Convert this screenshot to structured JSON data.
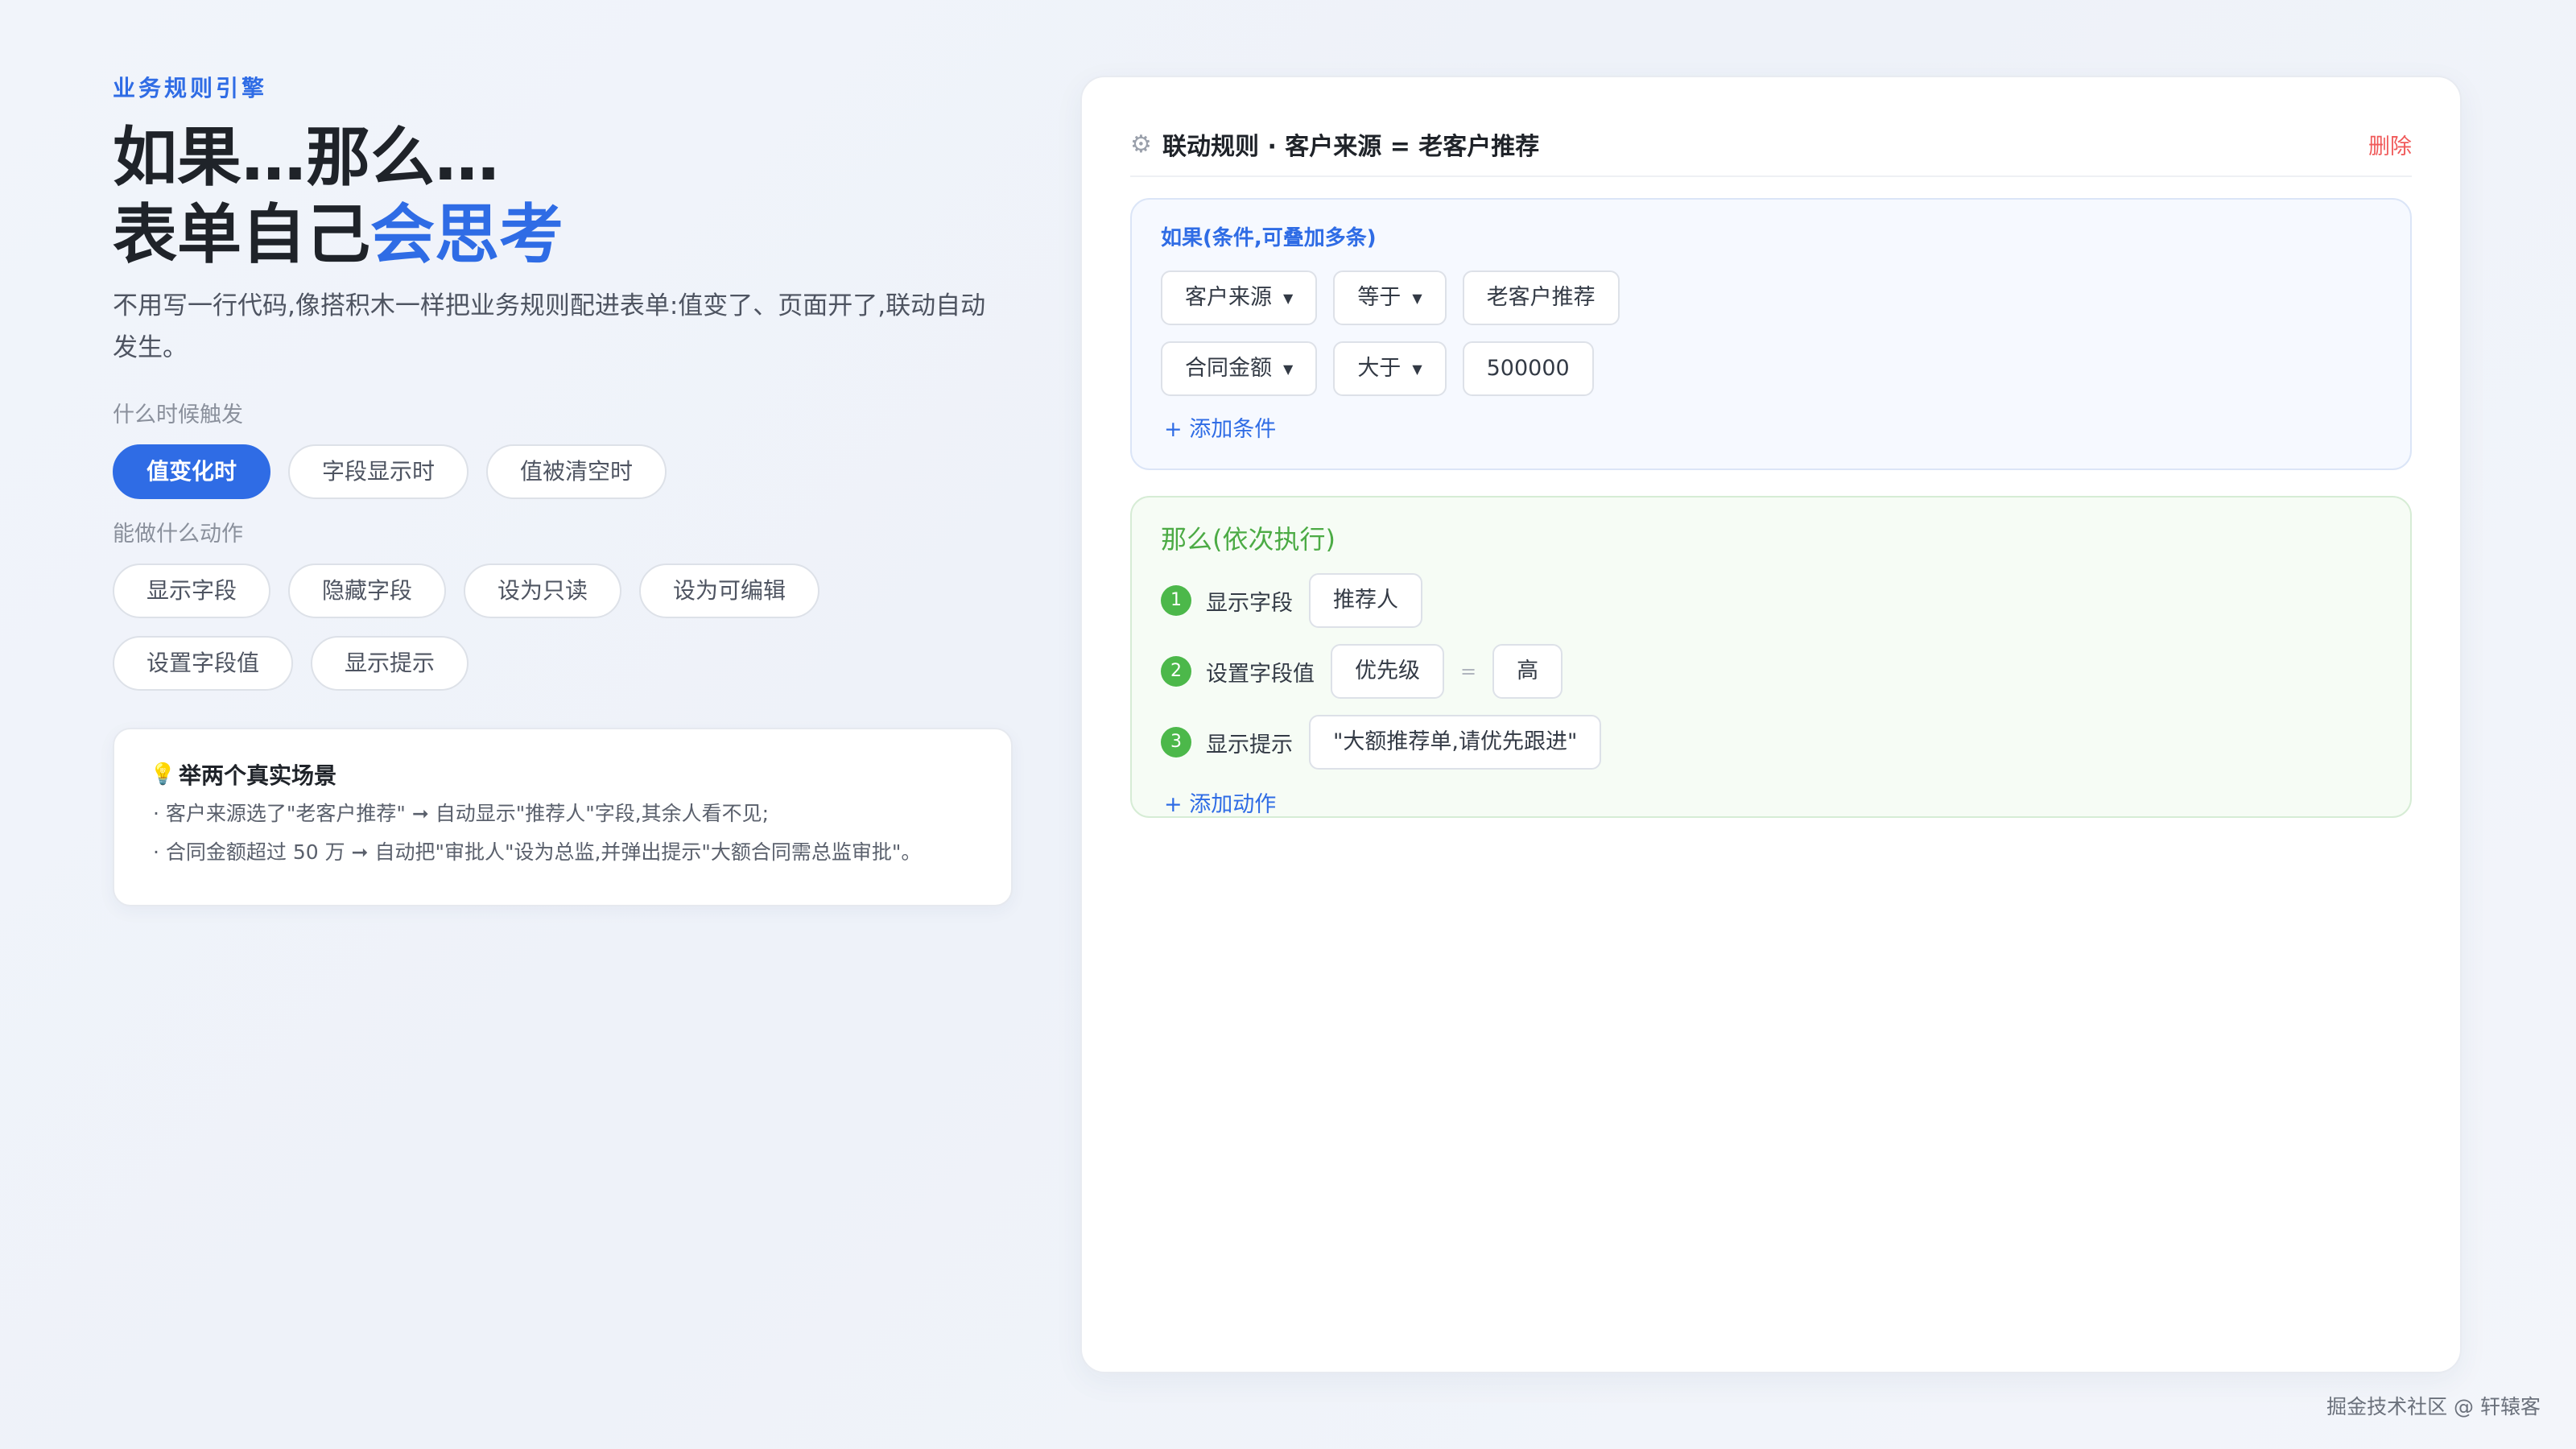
{
  "left": {
    "eyebrow": "业务规则引擎",
    "title_line1": "如果…那么…",
    "title_line2_prefix": "表单自己",
    "title_line2_accent": "会思考",
    "description": "不用写一行代码,像搭积木一样把业务规则配进表单:值变了、页面开了,联动自动发生。",
    "trigger_label": "什么时候触发",
    "triggers": [
      "值变化时",
      "字段显示时",
      "值被清空时"
    ],
    "action_label": "能做什么动作",
    "actions": [
      "显示字段",
      "隐藏字段",
      "设为只读",
      "设为可编辑",
      "设置字段值",
      "显示提示"
    ],
    "scenario": {
      "icon": "lightbulb-icon",
      "title": "举两个真实场景",
      "line1": "· 客户来源选了\"老客户推荐\" ➞ 自动显示\"推荐人\"字段,其余人看不见;",
      "line2": "· 合同金额超过 50 万 ➞ 自动把\"审批人\"设为总监,并弹出提示\"大额合同需总监审批\"。"
    }
  },
  "panel": {
    "icon": "gear-icon",
    "title": "联动规则 · 客户来源 = 老客户推荐",
    "delete_label": "删除",
    "if_section": {
      "title": "如果(条件,可叠加多条)",
      "conditions": [
        {
          "field": "客户来源",
          "operator": "等于",
          "value": "老客户推荐"
        },
        {
          "field": "合同金额",
          "operator": "大于",
          "value": "500000"
        }
      ],
      "add_label": "+ 添加条件"
    },
    "then_section": {
      "title": "那么(依次执行)",
      "steps": [
        {
          "num": "1",
          "action": "显示字段",
          "target": "推荐人"
        },
        {
          "num": "2",
          "action": "设置字段值",
          "target": "优先级",
          "eq": "=",
          "value": "高"
        },
        {
          "num": "3",
          "action": "显示提示",
          "target": "\"大额推荐单,请优先跟进\""
        }
      ],
      "add_label": "+ 添加动作"
    }
  },
  "footer": "掘金技术社区 @ 轩辕客",
  "colors": {
    "accent": "#2f6ce5",
    "success": "#4cb84a",
    "danger": "#f05a5a"
  }
}
